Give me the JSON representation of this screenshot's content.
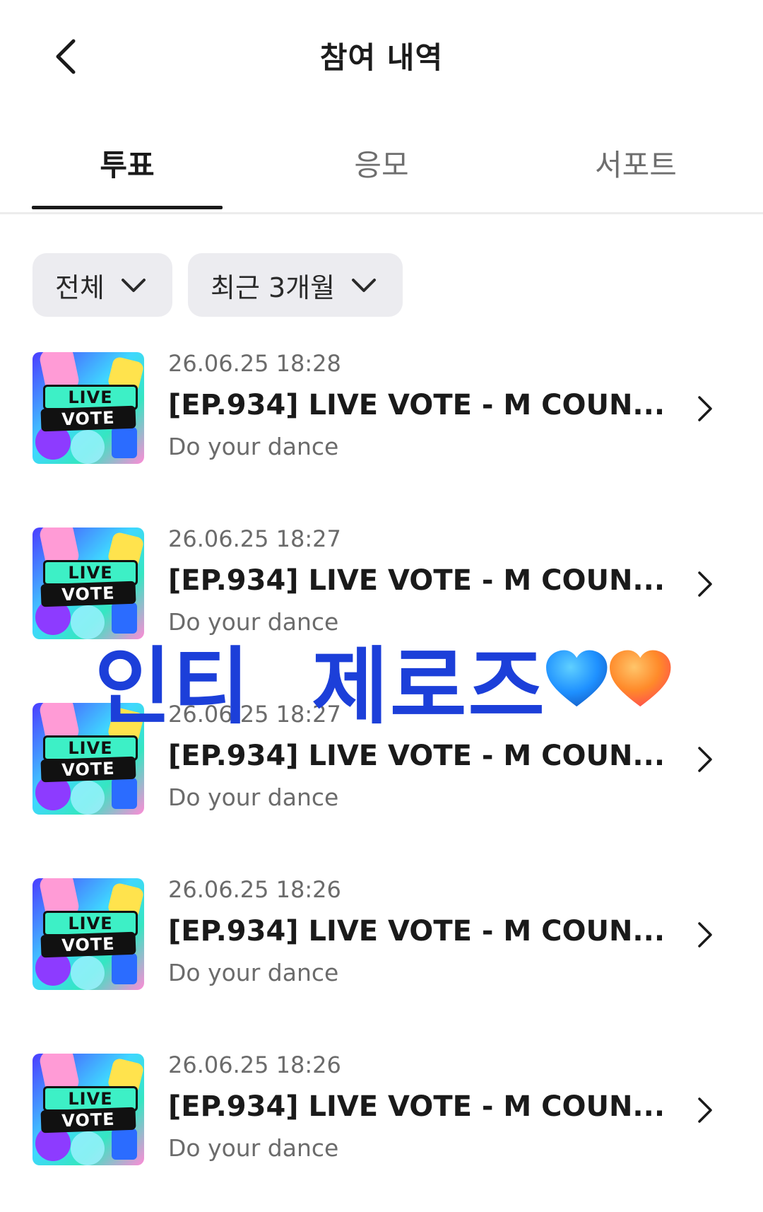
{
  "header": {
    "title": "참여 내역",
    "back_icon": "chevron-left-icon"
  },
  "tabs": [
    {
      "label": "투표",
      "active": true
    },
    {
      "label": "응모",
      "active": false
    },
    {
      "label": "서포트",
      "active": false
    }
  ],
  "filters": [
    {
      "label": "전체",
      "icon": "chevron-down-icon"
    },
    {
      "label": "최근 3개월",
      "icon": "chevron-down-icon"
    }
  ],
  "items": [
    {
      "date": "26.06.25 18:28",
      "title": "[EP.934] LIVE VOTE - M COUN...",
      "subtitle": "Do your dance",
      "thumb_top": "LIVE",
      "thumb_bottom": "VOTE"
    },
    {
      "date": "26.06.25 18:27",
      "title": "[EP.934] LIVE VOTE - M COUN...",
      "subtitle": "Do your dance",
      "thumb_top": "LIVE",
      "thumb_bottom": "VOTE"
    },
    {
      "date": "26.06.25 18:27",
      "title": "[EP.934] LIVE VOTE - M COUN...",
      "subtitle": "Do your dance",
      "thumb_top": "LIVE",
      "thumb_bottom": "VOTE"
    },
    {
      "date": "26.06.25 18:26",
      "title": "[EP.934] LIVE VOTE - M COUN...",
      "subtitle": "Do your dance",
      "thumb_top": "LIVE",
      "thumb_bottom": "VOTE"
    },
    {
      "date": "26.06.25 18:26",
      "title": "[EP.934] LIVE VOTE - M COUN...",
      "subtitle": "Do your dance",
      "thumb_top": "LIVE",
      "thumb_bottom": "VOTE"
    }
  ],
  "overlay": {
    "text": "인티  제로즈",
    "hearts": [
      "blue-heart-icon",
      "orange-heart-icon"
    ]
  },
  "colors": {
    "accent_text": "#1a1a1a",
    "muted_text": "#6b6b6b",
    "filter_bg": "#ececf0",
    "overlay_text": "#1c3fd9",
    "heart_blue": "#1e90ff",
    "heart_orange": "#ff7a1a"
  }
}
